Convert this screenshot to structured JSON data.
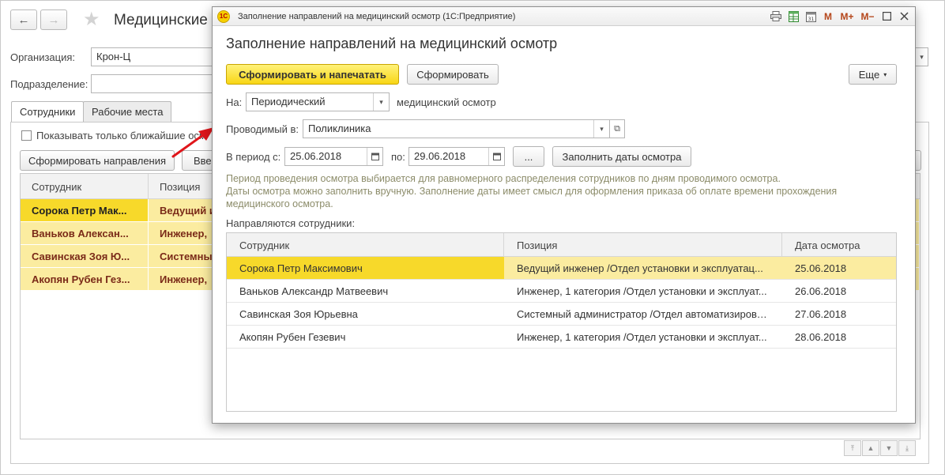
{
  "background": {
    "nav": {
      "back_icon": "←",
      "forward_icon": "→"
    },
    "title": "Медицинские",
    "org_label": "Организация:",
    "org_value": "Крон-Ц",
    "dept_label": "Подразделение:",
    "dept_value": "",
    "tabs": [
      {
        "label": "Сотрудники"
      },
      {
        "label": "Рабочие места"
      }
    ],
    "checkbox_label": "Показывать только ближайшие осм",
    "generate_btn": "Сформировать направления",
    "enter_btn": "Вве",
    "table": {
      "headers": [
        "Сотрудник",
        "Позиция"
      ],
      "rows": [
        {
          "name": "Сорока Петр Мак...",
          "position": "Ведущий и"
        },
        {
          "name": "Ваньков Алексан...",
          "position": "Инженер,"
        },
        {
          "name": "Савинская Зоя Ю...",
          "position": "Системный"
        },
        {
          "name": "Акопян Рубен Гез...",
          "position": "Инженер,"
        }
      ]
    }
  },
  "dialog": {
    "window_title": "Заполнение направлений на медицинский осмотр  (1С:Предприятие)",
    "logo_text": "1С",
    "title": "Заполнение направлений на медицинский осмотр",
    "buttons": {
      "form_print": "Сформировать и напечатать",
      "form": "Сформировать",
      "more": "Еще",
      "ellipsis": "...",
      "fill_dates": "Заполнить даты осмотра"
    },
    "type_label": "На:",
    "type_value": "Периодический",
    "type_suffix": "медицинский осмотр",
    "place_label": "Проводимый в:",
    "place_value": "Поликлиника",
    "period_label": "В период с:",
    "date_from": "25.06.2018",
    "to_label": "по:",
    "date_to": "29.06.2018",
    "hint_line1": "Период проведения осмотра выбирается для равномерного распределения сотрудников по дням проводимого осмотра.",
    "hint_line2": "Даты осмотра можно заполнить вручную. Заполнение даты имеет смысл для оформления приказа об оплате времени прохождения",
    "hint_line3": "медицинского осмотра.",
    "employees_label": "Направляются сотрудники:",
    "table": {
      "headers": [
        "Сотрудник",
        "Позиция",
        "Дата осмотра"
      ],
      "rows": [
        {
          "name": "Сорока Петр Максимович",
          "position": "Ведущий инженер /Отдел установки и эксплуатац...",
          "date": "25.06.2018"
        },
        {
          "name": "Ваньков Александр Матвеевич",
          "position": "Инженер, 1 категория /Отдел установки и эксплуат...",
          "date": "26.06.2018"
        },
        {
          "name": "Савинская Зоя Юрьевна",
          "position": "Системный администратор /Отдел автоматизирова...",
          "date": "27.06.2018"
        },
        {
          "name": "Акопян Рубен Гезевич",
          "position": "Инженер, 1 категория /Отдел установки и эксплуат...",
          "date": "28.06.2018"
        }
      ]
    },
    "titlebar_icons": {
      "m": "M",
      "mplus": "M+",
      "mminus": "M−"
    }
  },
  "colors": {
    "primary_button": "#f8d615",
    "selected_row": "#f7d92a",
    "row_highlight": "#fbeca0",
    "arrow": "#e0161b"
  }
}
